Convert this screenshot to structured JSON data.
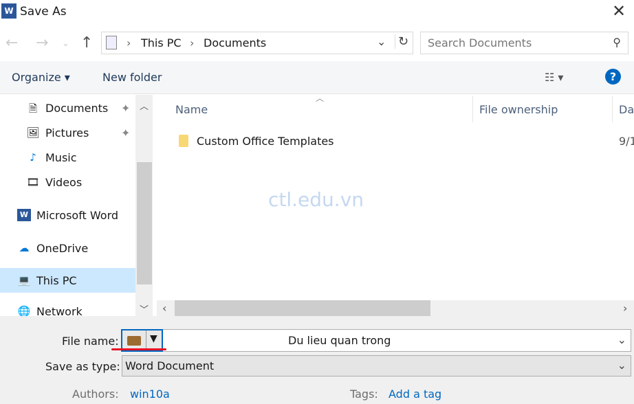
{
  "window": {
    "title": "Save As",
    "app_icon": "word-icon"
  },
  "address": {
    "crumbs": [
      "This PC",
      "Documents"
    ]
  },
  "search": {
    "placeholder": "Search Documents"
  },
  "toolbar": {
    "organize": "Organize",
    "new_folder": "New folder"
  },
  "sidebar": {
    "items": [
      {
        "label": "Documents",
        "icon": "documents-icon",
        "pinned": true
      },
      {
        "label": "Pictures",
        "icon": "pictures-icon",
        "pinned": true
      },
      {
        "label": "Music",
        "icon": "music-icon"
      },
      {
        "label": "Videos",
        "icon": "videos-icon"
      },
      {
        "label": "Microsoft Word",
        "icon": "word-icon"
      },
      {
        "label": "OneDrive",
        "icon": "onedrive-icon"
      },
      {
        "label": "This PC",
        "icon": "computer-icon",
        "selected": true
      },
      {
        "label": "Network",
        "icon": "network-icon"
      }
    ]
  },
  "columns": [
    "Name",
    "File ownership",
    "Da"
  ],
  "files": [
    {
      "name": "Custom Office Templates",
      "date": "9/1"
    }
  ],
  "watermark": "ctl.edu.vn",
  "form": {
    "file_name_label": "File name:",
    "file_name": "Du lieu quan trong",
    "type_label": "Save as type:",
    "type": "Word Document",
    "authors_label": "Authors:",
    "authors": "win10a",
    "tags_label": "Tags:",
    "tags": "Add a tag"
  },
  "colors": {
    "accent": "#0067c0",
    "selected": "#cce8ff",
    "underline": "#e81123"
  }
}
